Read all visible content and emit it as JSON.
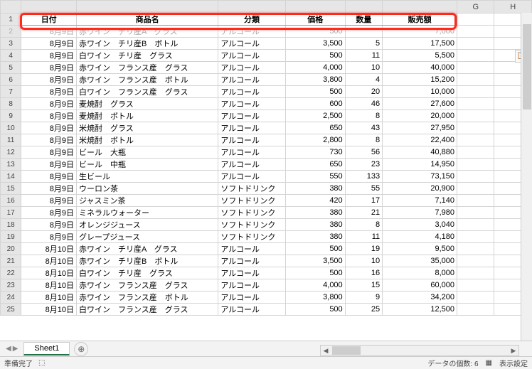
{
  "columns_letters": [
    "",
    "",
    "",
    "",
    "",
    "",
    "G",
    "H"
  ],
  "headers": [
    "日付",
    "商品名",
    "分類",
    "価格",
    "数量",
    "販売額"
  ],
  "row_obscured": {
    "n": 2,
    "a": "8月9日",
    "b": "赤ワイン　チリ産A　グラス",
    "c": "アルコール",
    "d": "500",
    "e": "",
    "f": "7,000"
  },
  "rows": [
    {
      "n": 3,
      "a": "8月9日",
      "b": "赤ワイン　チリ産B　ボトル",
      "c": "アルコール",
      "d": "3,500",
      "e": "5",
      "f": "17,500"
    },
    {
      "n": 4,
      "a": "8月9日",
      "b": "白ワイン　チリ産　グラス",
      "c": "アルコール",
      "d": "500",
      "e": "11",
      "f": "5,500"
    },
    {
      "n": 5,
      "a": "8月9日",
      "b": "赤ワイン　フランス産　グラス",
      "c": "アルコール",
      "d": "4,000",
      "e": "10",
      "f": "40,000"
    },
    {
      "n": 6,
      "a": "8月9日",
      "b": "赤ワイン　フランス産　ボトル",
      "c": "アルコール",
      "d": "3,800",
      "e": "4",
      "f": "15,200"
    },
    {
      "n": 7,
      "a": "8月9日",
      "b": "白ワイン　フランス産　グラス",
      "c": "アルコール",
      "d": "500",
      "e": "20",
      "f": "10,000"
    },
    {
      "n": 8,
      "a": "8月9日",
      "b": "麦焼酎　グラス",
      "c": "アルコール",
      "d": "600",
      "e": "46",
      "f": "27,600"
    },
    {
      "n": 9,
      "a": "8月9日",
      "b": "麦焼酎　ボトル",
      "c": "アルコール",
      "d": "2,500",
      "e": "8",
      "f": "20,000"
    },
    {
      "n": 10,
      "a": "8月9日",
      "b": "米焼酎　グラス",
      "c": "アルコール",
      "d": "650",
      "e": "43",
      "f": "27,950"
    },
    {
      "n": 11,
      "a": "8月9日",
      "b": "米焼酎　ボトル",
      "c": "アルコール",
      "d": "2,800",
      "e": "8",
      "f": "22,400"
    },
    {
      "n": 12,
      "a": "8月9日",
      "b": "ビール　大瓶",
      "c": "アルコール",
      "d": "730",
      "e": "56",
      "f": "40,880"
    },
    {
      "n": 13,
      "a": "8月9日",
      "b": "ビール　中瓶",
      "c": "アルコール",
      "d": "650",
      "e": "23",
      "f": "14,950"
    },
    {
      "n": 14,
      "a": "8月9日",
      "b": "生ビール",
      "c": "アルコール",
      "d": "550",
      "e": "133",
      "f": "73,150"
    },
    {
      "n": 15,
      "a": "8月9日",
      "b": "ウーロン茶",
      "c": "ソフトドリンク",
      "d": "380",
      "e": "55",
      "f": "20,900"
    },
    {
      "n": 16,
      "a": "8月9日",
      "b": "ジャスミン茶",
      "c": "ソフトドリンク",
      "d": "420",
      "e": "17",
      "f": "7,140"
    },
    {
      "n": 17,
      "a": "8月9日",
      "b": "ミネラルウォーター",
      "c": "ソフトドリンク",
      "d": "380",
      "e": "21",
      "f": "7,980"
    },
    {
      "n": 18,
      "a": "8月9日",
      "b": "オレンジジュース",
      "c": "ソフトドリンク",
      "d": "380",
      "e": "8",
      "f": "3,040"
    },
    {
      "n": 19,
      "a": "8月9日",
      "b": "グレープジュース",
      "c": "ソフトドリンク",
      "d": "380",
      "e": "11",
      "f": "4,180"
    },
    {
      "n": 20,
      "a": "8月10日",
      "b": "赤ワイン　チリ産A　グラス",
      "c": "アルコール",
      "d": "500",
      "e": "19",
      "f": "9,500"
    },
    {
      "n": 21,
      "a": "8月10日",
      "b": "赤ワイン　チリ産B　ボトル",
      "c": "アルコール",
      "d": "3,500",
      "e": "10",
      "f": "35,000"
    },
    {
      "n": 22,
      "a": "8月10日",
      "b": "白ワイン　チリ産　グラス",
      "c": "アルコール",
      "d": "500",
      "e": "16",
      "f": "8,000"
    },
    {
      "n": 23,
      "a": "8月10日",
      "b": "赤ワイン　フランス産　グラス",
      "c": "アルコール",
      "d": "4,000",
      "e": "15",
      "f": "60,000"
    },
    {
      "n": 24,
      "a": "8月10日",
      "b": "赤ワイン　フランス産　ボトル",
      "c": "アルコール",
      "d": "3,800",
      "e": "9",
      "f": "34,200"
    },
    {
      "n": 25,
      "a": "8月10日",
      "b": "白ワイン　フランス産　グラス",
      "c": "アルコール",
      "d": "500",
      "e": "25",
      "f": "12,500"
    }
  ],
  "sheet_tab": "Sheet1",
  "status": {
    "ready": "準備完了",
    "count_label": "データの個数: 6",
    "display": "表示設定"
  }
}
